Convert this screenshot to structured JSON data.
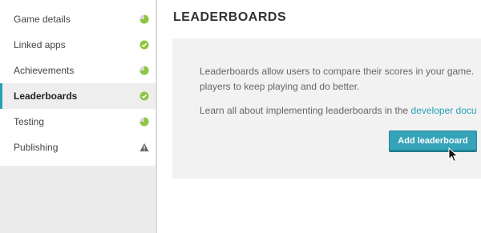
{
  "sidebar": {
    "items": [
      {
        "label": "Game details",
        "status": "partial"
      },
      {
        "label": "Linked apps",
        "status": "complete"
      },
      {
        "label": "Achievements",
        "status": "partial"
      },
      {
        "label": "Leaderboards",
        "status": "complete",
        "active": true
      },
      {
        "label": "Testing",
        "status": "partial"
      },
      {
        "label": "Publishing",
        "status": "warning"
      }
    ]
  },
  "main": {
    "title": "LEADERBOARDS",
    "description_line1": "Leaderboards allow users to compare their scores in your game.",
    "description_line2": "players to keep playing and do better.",
    "learn_text": "Learn all about implementing leaderboards in the ",
    "learn_link": "developer docu",
    "add_button": "Add leaderboard"
  },
  "colors": {
    "accent": "#26a0b6",
    "status_complete": "#8dc63f",
    "status_warning": "#666666"
  }
}
